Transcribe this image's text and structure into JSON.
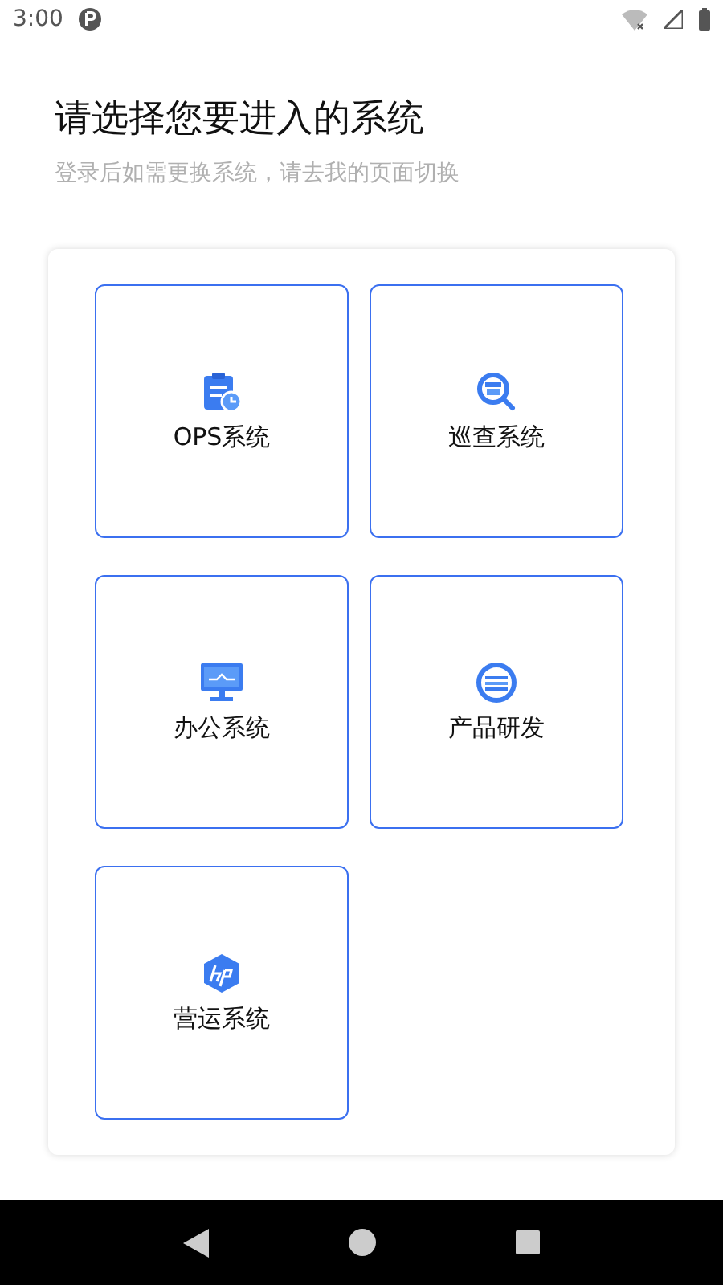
{
  "status_bar": {
    "time": "3:00"
  },
  "title": "请选择您要进入的系统",
  "subtitle": "登录后如需更换系统，请去我的页面切换",
  "systems": [
    {
      "label": "OPS系统"
    },
    {
      "label": "巡查系统"
    },
    {
      "label": "办公系统"
    },
    {
      "label": "产品研发"
    },
    {
      "label": "营运系统"
    }
  ]
}
